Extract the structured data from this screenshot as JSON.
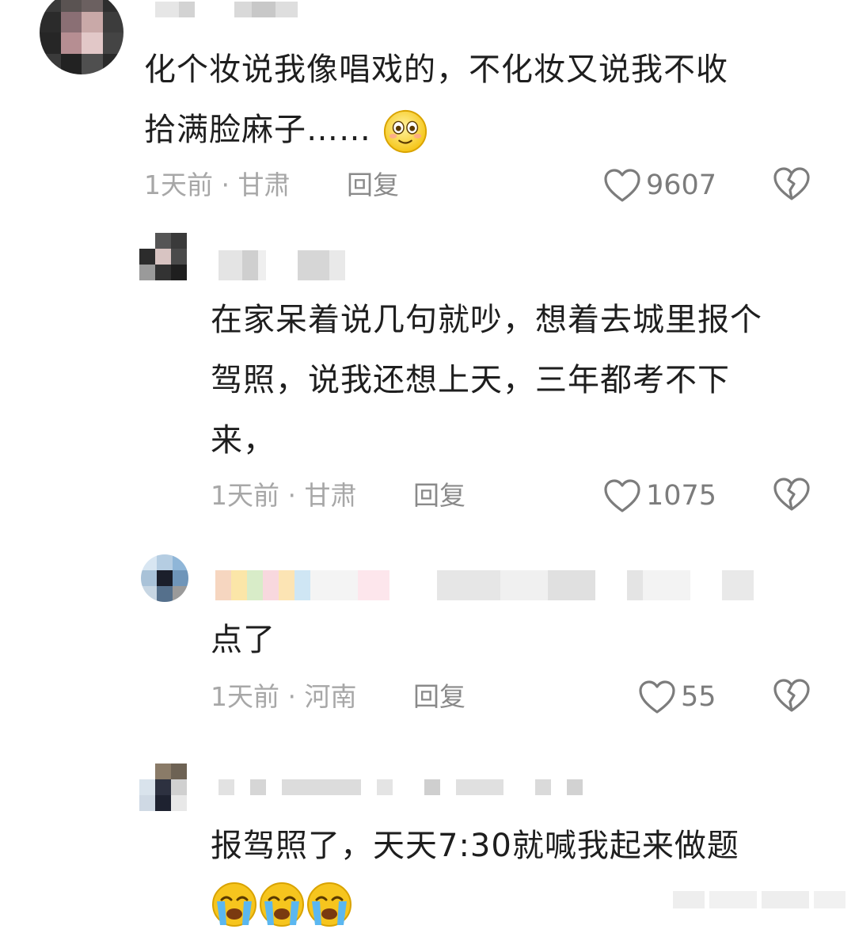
{
  "comments": [
    {
      "text_lines": [
        "化个妆说我像唱戏的，不化妆又说我不收",
        "拾满脸麻子……"
      ],
      "time": "1天前 · 甘肃",
      "reply_label": "回复",
      "likes": "9607",
      "emoji": "smiling-face-icon"
    },
    {
      "text_lines": [
        "在家呆着说几句就吵，想着去城里报个",
        "驾照，说我还想上天，三年都考不下",
        "来，"
      ],
      "time": "1天前 · 甘肃",
      "reply_label": "回复",
      "likes": "1075"
    },
    {
      "text_lines": [
        "点了"
      ],
      "time": "1天前 · 河南",
      "reply_label": "回复",
      "likes": "55"
    },
    {
      "text_lines": [
        "报驾照了，天天7:30就喊我起来做题"
      ],
      "emojis": [
        "crying-face-icon",
        "crying-face-icon",
        "crying-face-icon"
      ]
    }
  ],
  "colors": {
    "text": "#1e1e1e",
    "meta": "#a7a7a7",
    "icon": "#7c7c7c"
  }
}
